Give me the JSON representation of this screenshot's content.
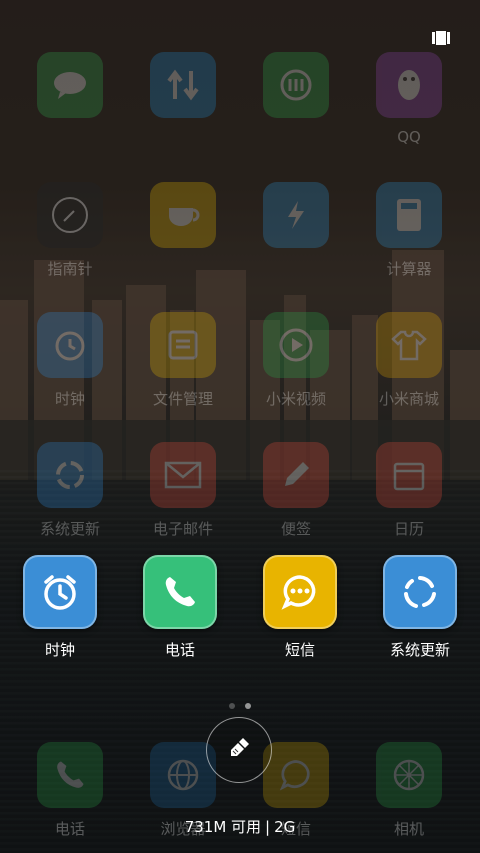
{
  "top_bar": {
    "icon": "recent-apps-menu-icon"
  },
  "background_grid": {
    "rows": [
      [
        {
          "label": "",
          "icon": "chat-icon",
          "color": "#2fa84f"
        },
        {
          "label": "",
          "icon": "transfer-arrows-icon",
          "color": "#1e88c9"
        },
        {
          "label": "",
          "icon": "mi-logo-icon",
          "color": "#2aa84a"
        },
        {
          "label": "QQ",
          "icon": "penguin-icon",
          "color": "#8e44ad"
        }
      ],
      [
        {
          "label": "指南针",
          "icon": "compass-icon",
          "color": "#222222"
        },
        {
          "label": "",
          "icon": "coffee-cup-icon",
          "color": "#e0b200"
        },
        {
          "label": "",
          "icon": "flash-icon",
          "color": "#2a8fcf"
        },
        {
          "label": "计算器",
          "icon": "calculator-icon",
          "color": "#2a8fcf"
        }
      ],
      [
        {
          "label": "时钟",
          "icon": "clock-icon",
          "color": "#2d88d6"
        },
        {
          "label": "文件管理",
          "icon": "folder-icon",
          "color": "#e0b200"
        },
        {
          "label": "小米视频",
          "icon": "play-icon",
          "color": "#28a84a"
        },
        {
          "label": "小米商城",
          "icon": "shirt-icon",
          "color": "#e0a400"
        }
      ],
      [
        {
          "label": "系统更新",
          "icon": "refresh-icon",
          "color": "#2d88d6"
        },
        {
          "label": "电子邮件",
          "icon": "mail-icon",
          "color": "#e04a3a"
        },
        {
          "label": "便签",
          "icon": "pencil-icon",
          "color": "#e04a3a"
        },
        {
          "label": "日历",
          "icon": "calendar-icon",
          "color": "#e04a3a"
        }
      ]
    ]
  },
  "recent_apps": [
    {
      "label": "时钟",
      "icon": "alarm-clock-icon",
      "color": "#3b8ed6"
    },
    {
      "label": "电话",
      "icon": "phone-icon",
      "color": "#36c07a"
    },
    {
      "label": "短信",
      "icon": "message-bubble-icon",
      "color": "#e8b400"
    },
    {
      "label": "系统更新",
      "icon": "update-cycle-icon",
      "color": "#3b8ed6"
    }
  ],
  "page_indicator": {
    "total": 2,
    "active": 1
  },
  "clean_button": {
    "icon": "broom-icon"
  },
  "memory": {
    "available": "731M 可用",
    "ram": "2G"
  },
  "dock": [
    {
      "label": "电话",
      "icon": "phone-icon",
      "color": "#2aa84a"
    },
    {
      "label": "浏览器",
      "icon": "globe-icon",
      "color": "#1e6fae"
    },
    {
      "label": "短信",
      "icon": "message-bubble-icon",
      "color": "#e0b200"
    },
    {
      "label": "相机",
      "icon": "camera-lens-icon",
      "color": "#2aa84a"
    }
  ]
}
